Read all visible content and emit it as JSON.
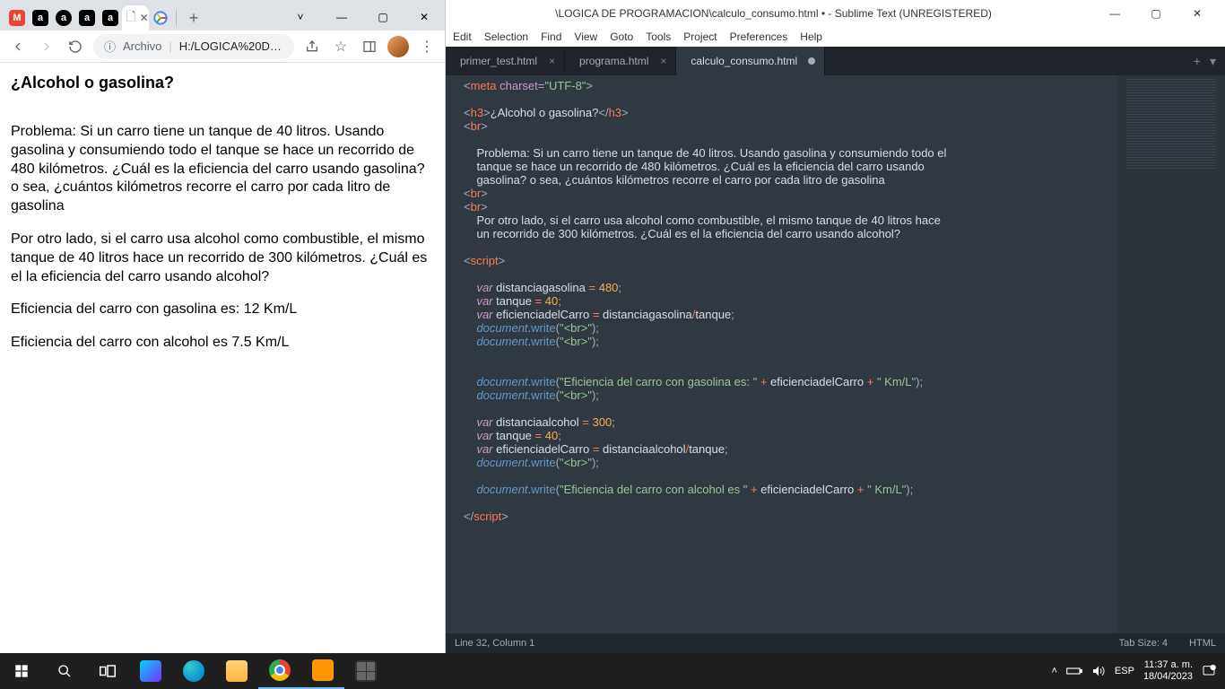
{
  "chrome": {
    "tabs": {
      "gmail": "M",
      "a_label": "a",
      "active_doc": "",
      "google": "G",
      "plus": "+"
    },
    "win_controls": {
      "down": "˅",
      "min": "—",
      "max": "▢",
      "close": "✕"
    },
    "toolbar": {
      "url_prefix": "Archivo",
      "url": "H:/LOGICA%20D…"
    },
    "page": {
      "title": "¿Alcohol o gasolina?",
      "p1": "Problema: Si un carro tiene un tanque de 40 litros. Usando gasolina y consumiendo todo el tanque se hace un recorrido de 480 kilómetros. ¿Cuál es la eficiencia del carro usando gasolina? o sea, ¿cuántos kilómetros recorre el carro por cada litro de gasolina",
      "p2": "Por otro lado, si el carro usa alcohol como combustible, el mismo tanque de 40 litros hace un recorrido de 300 kilómetros. ¿Cuál es el la eficiencia del carro usando alcohol?",
      "p3": "Eficiencia del carro con gasolina es: 12 Km/L",
      "p4": "Eficiencia del carro con alcohol es 7.5 Km/L"
    }
  },
  "sublime": {
    "title": "\\LOGICA DE PROGRAMACION\\calculo_consumo.html • - Sublime Text (UNREGISTERED)",
    "menu": [
      "Edit",
      "Selection",
      "Find",
      "View",
      "Goto",
      "Tools",
      "Project",
      "Preferences",
      "Help"
    ],
    "tabs": [
      {
        "name": "primer_test.html",
        "active": false,
        "dirty": false
      },
      {
        "name": "programa.html",
        "active": false,
        "dirty": false
      },
      {
        "name": "calculo_consumo.html",
        "active": true,
        "dirty": true
      }
    ],
    "status": {
      "pos": "Line 32, Column 1",
      "tab": "Tab Size: 4",
      "lang": "HTML"
    }
  },
  "taskbar": {
    "lang": "ESP",
    "time": "11:37 a. m.",
    "date": "18/04/2023"
  }
}
